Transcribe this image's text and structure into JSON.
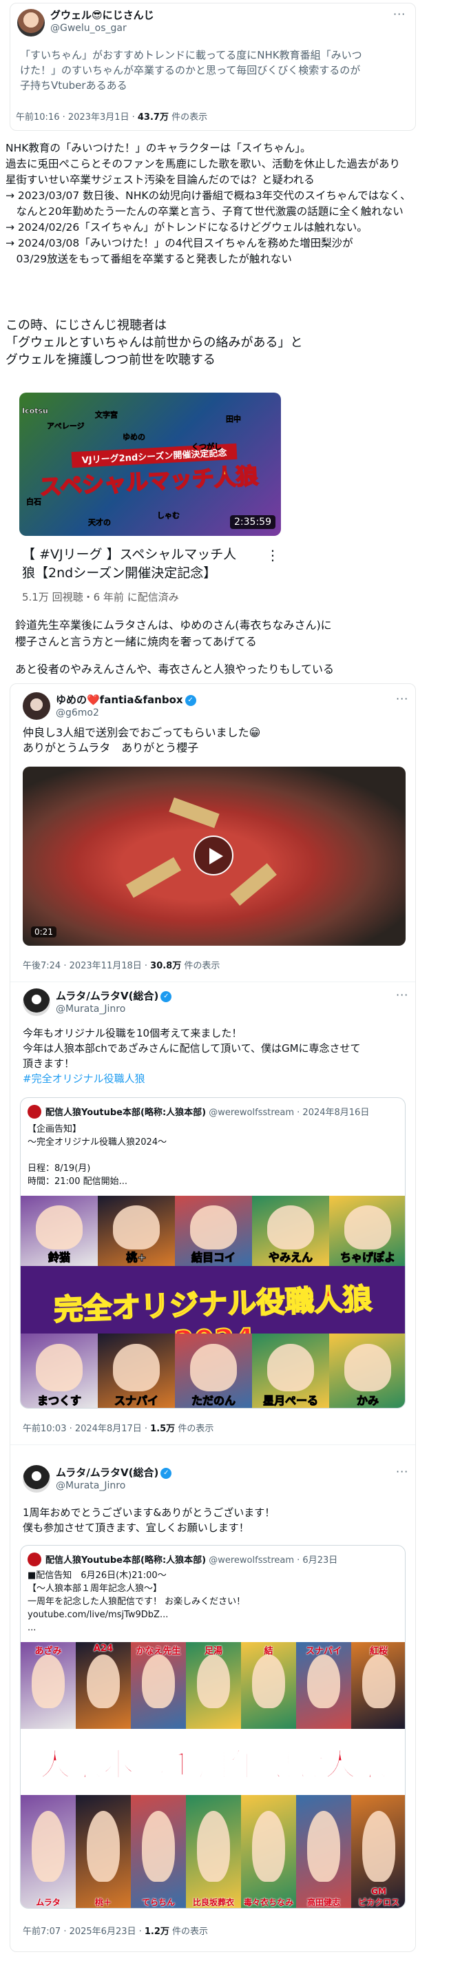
{
  "tweet1": {
    "name": "グウェル😎にじさんじ",
    "handle": "@Gwelu_os_gar",
    "text": "「すいちゃん」がおすすめトレンドに載ってる度にNHK教育番組「みいつ\nけた！」のすいちゃんが卒業するのかと思って毎回びくびく検索するのが\n子持ちVtuberあるある",
    "time": "午前10:16 · 2023年3月1日 · ",
    "views": "43.7万",
    "views_suffix": " 件の表示"
  },
  "article": {
    "intro": "NHK教育の「みいつけた！」のキャラクターは「スイちゃん」。\n過去に兎田ぺこらとそのファンを馬鹿にした歌を歌い、活動を休止した過去があり\n星街すいせい卒業サジェスト汚染を目論んだのでは？と疑われる\n→ 2023/03/07 数日後、NHKの幼児向け番組で概ね3年交代のスイちゃんではなく、\n　なんと20年勤めたう一たんの卒業と言う、子育て世代激震の話題に全く触れない\n→ 2024/02/26「スイちゃん」がトレンドになるけどグウェルは触れない。\n→ 2024/03/08「みいつけた！」の4代目スイちゃんを務めた増田梨沙が\n　03/29放送をもって番組を卒業すると発表したが触れない",
    "para2": "この時、にじさんじ視聴者は\n「グウェルとすいちゃんは前世からの絡みがある」と\nグウェルを擁護しつつ前世を吹聴する",
    "para3": "鈴道先生卒業後にムラタさんは、ゆめのさん(毒衣ちなみさん)に\n櫻子さんと言う方と一緒に焼肉を奢ってあげてる",
    "para4": "あと役者のやみえんさんや、毒衣さんと人狼やったりもしている"
  },
  "video": {
    "thumb_title": "スペシャルマッチ人狼",
    "thumb_banner": "VJリーグ2ndシーズン開催決定記念",
    "thumb_names": [
      "Icotsu",
      "アベレージ",
      "文字宮",
      "ゆめの",
      "田中",
      "くつがし",
      "白石",
      "天才の",
      "しゃむ"
    ],
    "duration": "2:35:59",
    "title": "【 #VJリーグ 】スペシャルマッチ人\n狼【2ndシーズン開催決定記念】",
    "meta": "5.1万 回視聴・6 年前 に配信済み"
  },
  "tweet2": {
    "name": "ゆめの❤️fantia&fanbox",
    "handle": "@g6mo2",
    "text": "仲良し3人組で送別会でおごってもらいました😁\nありがとうムラタ　ありがとう櫻子",
    "duration": "0:21",
    "time": "午後7:24 · 2023年11月18日 · ",
    "views": "30.8万",
    "views_suffix": " 件の表示"
  },
  "tweet3": {
    "name": "ムラタ/ムラタV(総合)",
    "handle": "@Murata_Jinro",
    "text": "今年もオリジナル役職を10個考えて来ました！\n今年は人狼本部chであざみさんに配信して頂いて、僕はGMに専念させて\n頂きます！",
    "hashtag": "#完全オリジナル役職人狼",
    "quote": {
      "name": "配信人狼Youtube本部(略称:人狼本部)",
      "handle": "@werewolfsstream · 2024年8月16日",
      "text": "【企画告知】\n～完全オリジナル役職人狼2024～\n\n日程：8/19(月)\n時間：21:00 配信開始...",
      "banner": "完全オリジナル役職人狼2024",
      "names_top": [
        "鈴猫",
        "桃+",
        "結目コイ",
        "やみえん",
        "ちゃげぽよ"
      ],
      "names_bottom": [
        "まつくす",
        "スナパイ",
        "ただのん",
        "星月ぺーる",
        "かみ"
      ]
    },
    "time": "午前10:03 · 2024年8月17日 · ",
    "views": "1.5万",
    "views_suffix": " 件の表示"
  },
  "tweet4": {
    "name": "ムラタ/ムラタV(総合)",
    "handle": "@Murata_Jinro",
    "text": "1周年おめでとうございます&ありがとうございます！\n僕も参加させて頂きます、宜しくお願いします！",
    "quote": {
      "name": "配信人狼Youtube本部(略称:人狼本部)",
      "handle": "@werewolfsstream · 6月23日",
      "text": "■配信告知　6月26日(木)21:00～\n【～人狼本部１周年記念人狼～】\n一周年を記念した人狼配信です！ お楽しみください！\nyoutube.com/live/msjTw9DbZ...\n...",
      "banner": "人狼本部１周年記念人狼",
      "names_top": [
        "あざみ",
        "A24",
        "かなえ先生",
        "足湯",
        "結",
        "スナパイ",
        "紅桜"
      ],
      "names_bottom": [
        "ムラタ",
        "桃＋",
        "てらちん",
        "比良坂葬衣",
        "毒々衣ちなみ",
        "高田健志",
        "GM\nピカクロス"
      ]
    },
    "time": "午前7:07 · 2025年6月23日 · ",
    "views": "1.2万",
    "views_suffix": " 件の表示"
  },
  "colors": {
    "link": "#1d9bf0",
    "muted": "#536471",
    "red": "#e0001b"
  }
}
